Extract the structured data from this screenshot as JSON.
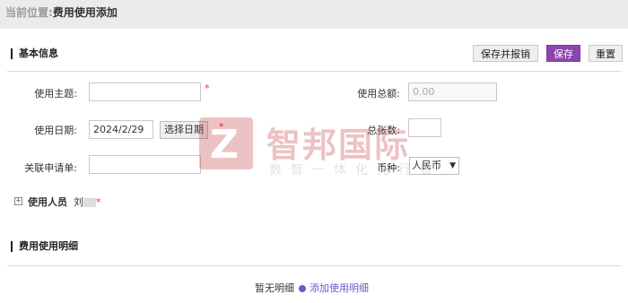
{
  "breadcrumb": {
    "prefix": "当前位置:",
    "current": "费用使用添加"
  },
  "basic": {
    "title": "基本信息",
    "buttons": {
      "save_submit": "保存并报销",
      "save": "保存",
      "reset": "重置"
    },
    "fields": {
      "subject_label": "使用主题:",
      "subject_value": "",
      "total_label": "使用总额:",
      "total_placeholder": "0.00",
      "date_label": "使用日期:",
      "date_value": "2024/2/29",
      "date_button": "选择日期",
      "count_label": "总张数:",
      "count_value": "",
      "related_label": "关联申请单:",
      "related_value": "",
      "currency_label": "币种:",
      "currency_value": "人民币",
      "required_mark": "*"
    },
    "users": {
      "toggle": "⊞",
      "label": "使用人员",
      "value": "刘"
    }
  },
  "detail": {
    "title": "费用使用明细",
    "empty_text": "暂无明细",
    "add_link": "添加使用明细"
  },
  "watermark": {
    "logo_letter": "Z",
    "name": "智邦国际",
    "slogan": "数智一体化先行者"
  },
  "colors": {
    "primary": "#8e44ad",
    "required": "#e0342f",
    "link": "#6a5acd",
    "watermark": "#c0272d"
  }
}
